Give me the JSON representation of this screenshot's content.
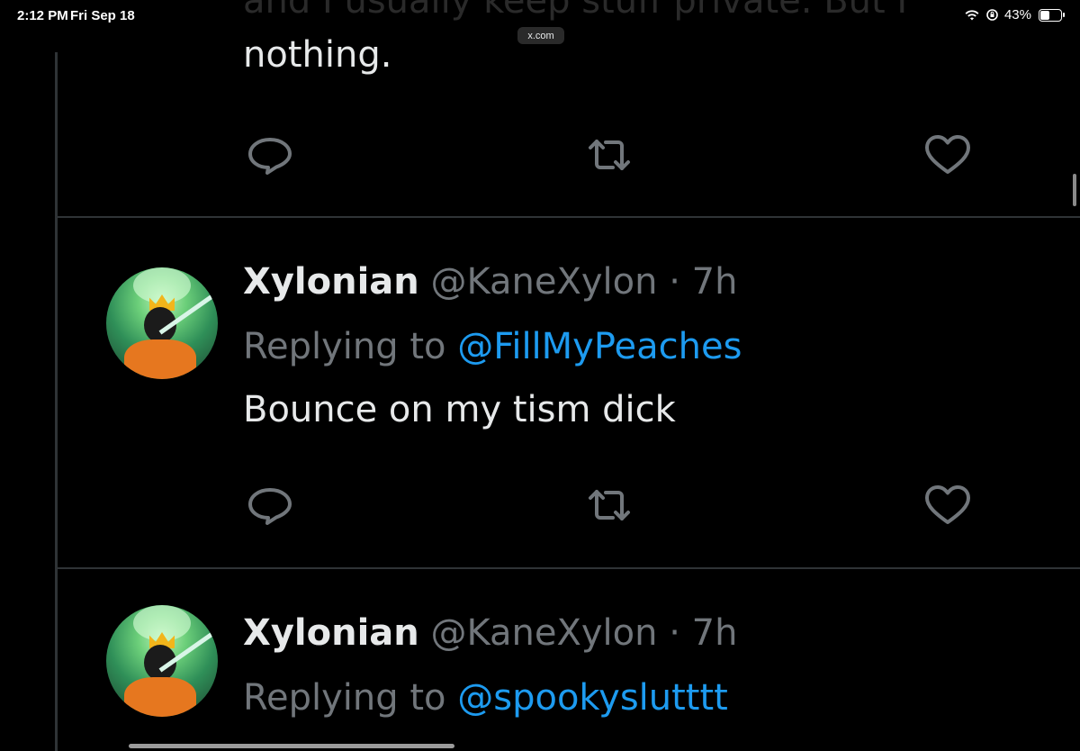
{
  "status_bar": {
    "time": "2:12 PM",
    "date": "Fri Sep 18",
    "battery": "43%",
    "battery_level": 0.43,
    "icons": [
      "wifi-icon",
      "orientation-lock-icon",
      "battery-icon"
    ]
  },
  "browser": {
    "url": "x.com"
  },
  "previous_tweet": {
    "ghost_text": "and I usually keep stuff private. But I",
    "text_tail": "nothing."
  },
  "replies": [
    {
      "display_name": "Xylonian",
      "handle": "@KaneXylon",
      "separator": "·",
      "time": "7h",
      "replying_prefix": "Replying to",
      "replying_to": "@FillMyPeaches",
      "text": "Bounce on my tism dick"
    },
    {
      "display_name": "Xylonian",
      "handle": "@KaneXylon",
      "separator": "·",
      "time": "7h",
      "replying_prefix": "Replying to",
      "replying_to": "@spookyslutttt",
      "text": ""
    }
  ],
  "actions": [
    "reply-icon",
    "retweet-icon",
    "like-icon"
  ],
  "colors": {
    "background": "#000000",
    "text": "#e7e9ea",
    "muted": "#71767b",
    "link": "#1d9bf0",
    "border": "#2f3336"
  }
}
